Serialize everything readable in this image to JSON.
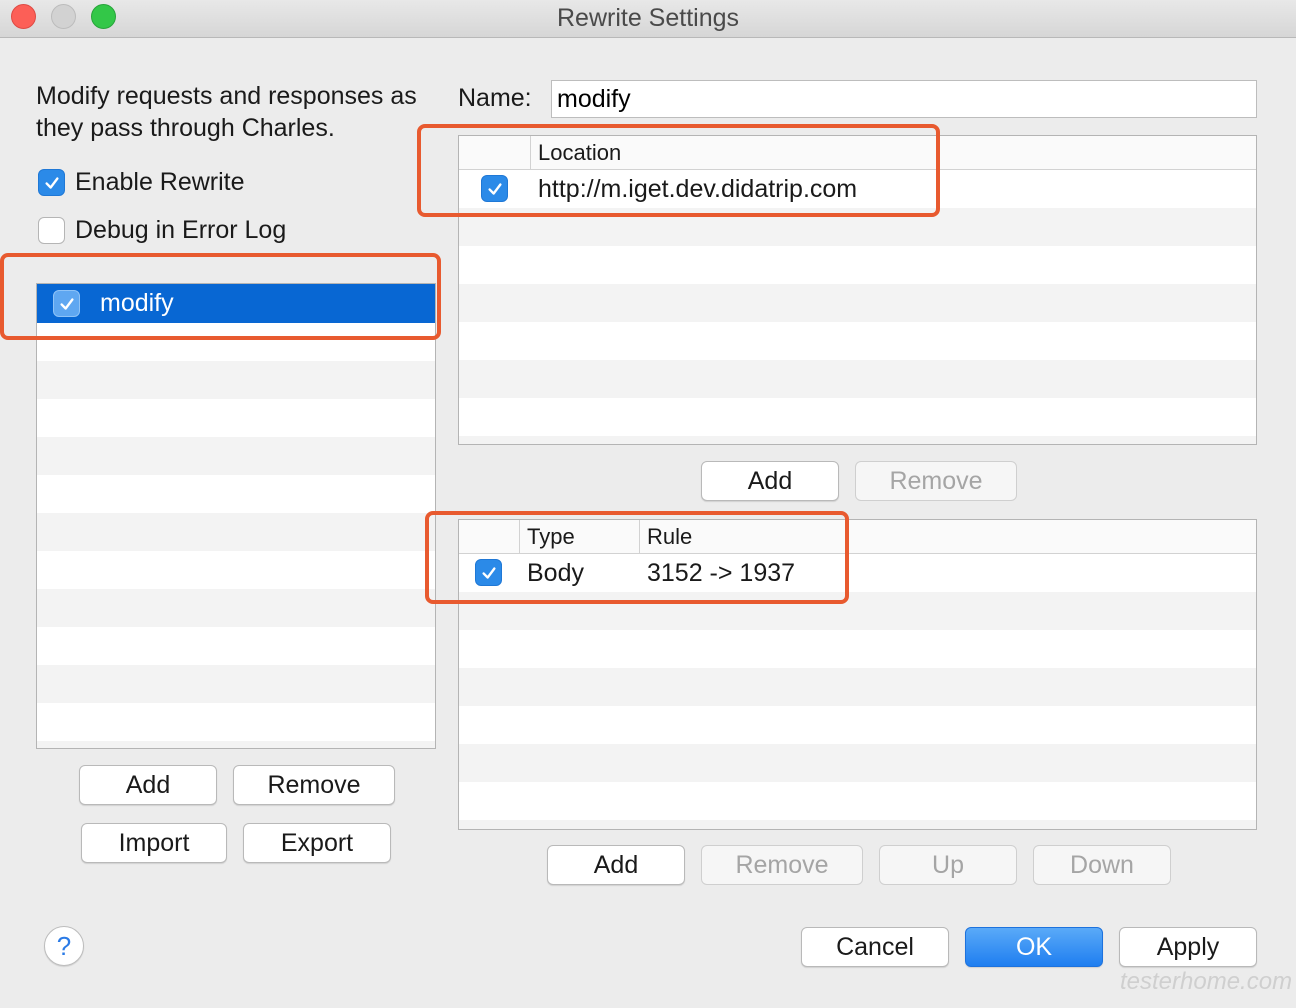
{
  "window": {
    "title": "Rewrite Settings"
  },
  "description": "Modify requests and responses as they pass through Charles.",
  "options": {
    "enable_rewrite": {
      "label": "Enable Rewrite",
      "checked": true
    },
    "debug_in_error_log": {
      "label": "Debug in Error Log",
      "checked": false
    }
  },
  "rule_sets": [
    {
      "name": "modify",
      "enabled": true,
      "selected": true
    }
  ],
  "left_buttons": {
    "add": "Add",
    "remove": "Remove",
    "import": "Import",
    "export": "Export"
  },
  "name_field": {
    "label": "Name:",
    "value": "modify"
  },
  "locations": {
    "columns": [
      "",
      "Location"
    ],
    "rows": [
      {
        "enabled": true,
        "location": "http://m.iget.dev.didatrip.com"
      }
    ],
    "buttons": {
      "add": "Add",
      "remove": "Remove"
    }
  },
  "rules": {
    "columns": [
      "",
      "Type",
      "Rule"
    ],
    "rows": [
      {
        "enabled": true,
        "type": "Body",
        "rule": "3152 -> 1937"
      }
    ],
    "buttons": {
      "add": "Add",
      "remove": "Remove",
      "up": "Up",
      "down": "Down"
    }
  },
  "footer": {
    "help": "?",
    "cancel": "Cancel",
    "ok": "OK",
    "apply": "Apply"
  },
  "watermark": "testerhome.com",
  "colors": {
    "accent": "#0867d3",
    "checkbox": "#2b8ae8",
    "highlight": "#e85a2f"
  }
}
